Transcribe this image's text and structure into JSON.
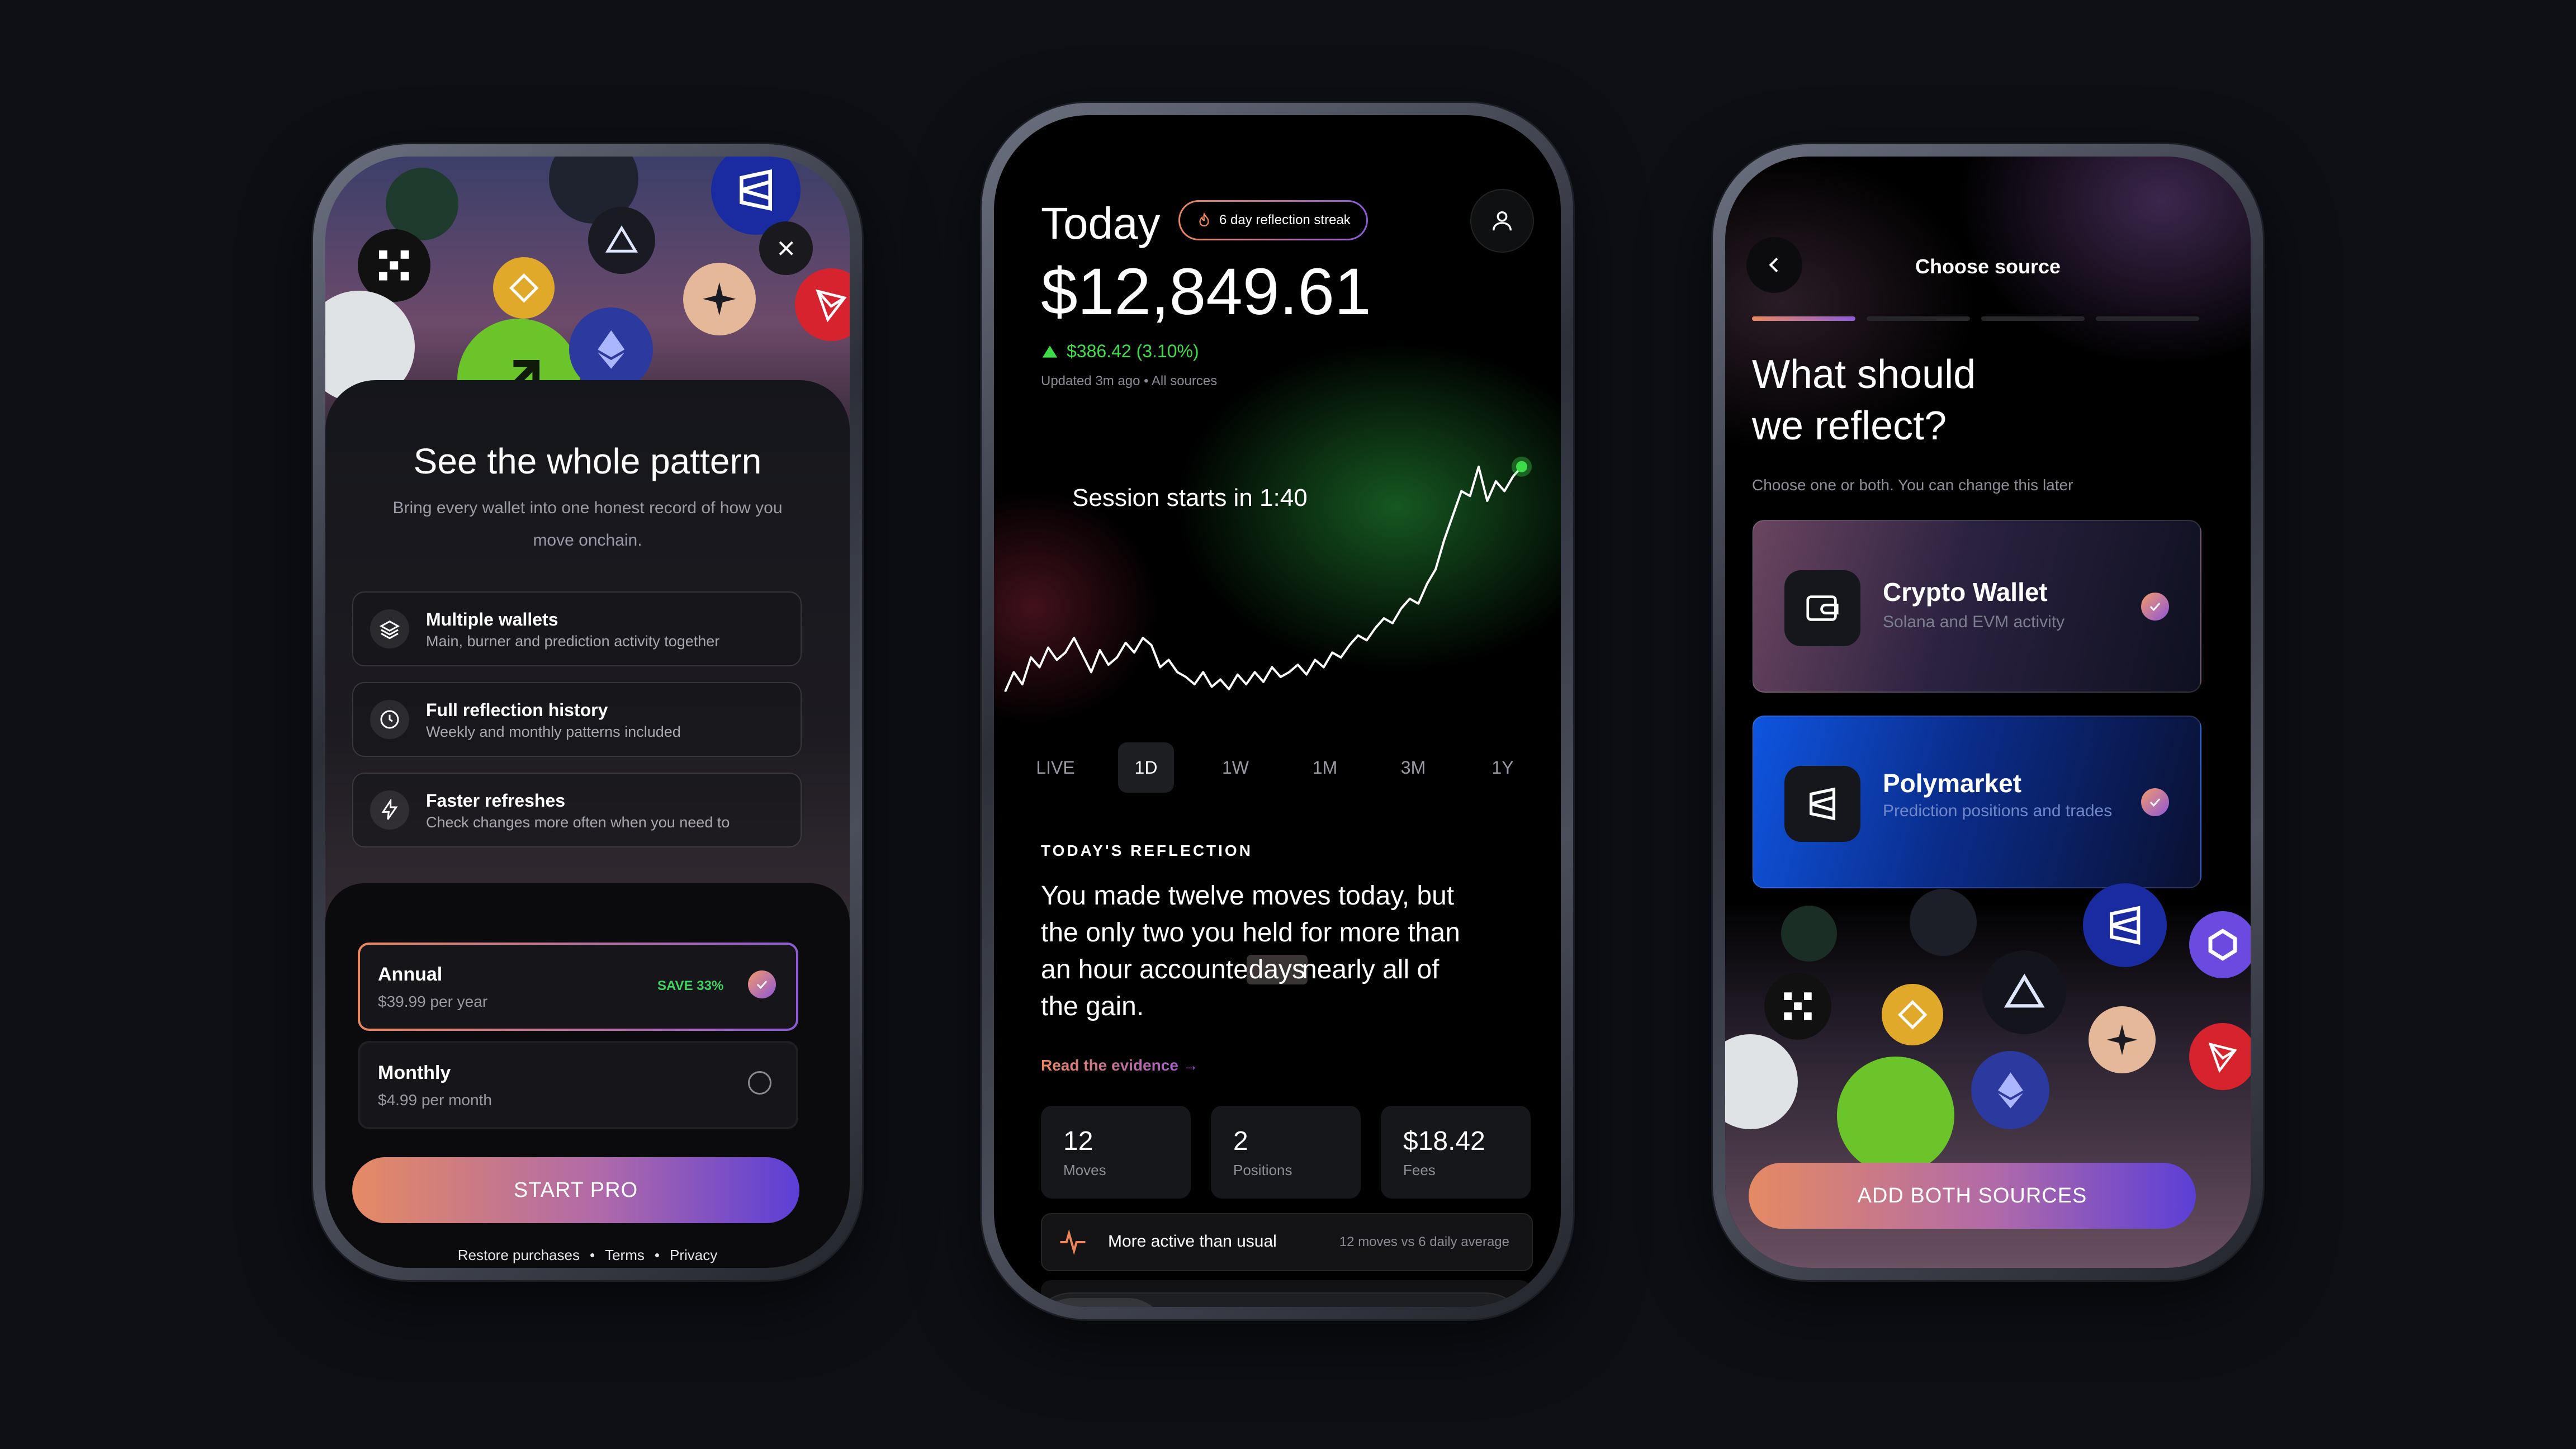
{
  "paywall": {
    "title": "See the whole pattern",
    "subtitle_line1": "Bring every wallet into one honest record of how you",
    "subtitle_line2": "move onchain.",
    "features": [
      {
        "title": "Multiple wallets",
        "desc": "Main, burner and prediction activity together",
        "icon": "layers-icon"
      },
      {
        "title": "Full reflection history",
        "desc": "Weekly and monthly patterns included",
        "icon": "clock-icon"
      },
      {
        "title": "Faster refreshes",
        "desc": "Check changes more often when you need to",
        "icon": "bolt-icon"
      }
    ],
    "plans": [
      {
        "name": "Annual",
        "price": "$39.99 per year",
        "badge": "SAVE 33%",
        "selected": true
      },
      {
        "name": "Monthly",
        "price": "$4.99 per month",
        "selected": false
      }
    ],
    "cta": "START PRO",
    "footer": {
      "restore": "Restore purchases",
      "terms": "Terms",
      "privacy": "Privacy",
      "sep": "•"
    },
    "close_icon": "close-icon"
  },
  "today": {
    "title": "Today",
    "streak": "6 day reflection streak",
    "balance": "$12,849.61",
    "change": "$386.42 (3.10%)",
    "updated": "Updated 3m ago • All sources",
    "session_label": "Session starts in 1:40",
    "timeframes": [
      "LIVE",
      "1D",
      "1W",
      "1M",
      "3M",
      "1Y"
    ],
    "active_timeframe": "1D",
    "reflection_heading": "TODAY'S REFLECTION",
    "reflection_lines": [
      "You made twelve moves today, but",
      "the only two you held for more than",
      "an hour accounted",
      "days",
      "nearly all of",
      "the gain."
    ],
    "read_evidence": "Read the evidence →",
    "stats": [
      {
        "value": "12",
        "label": "Moves"
      },
      {
        "value": "2",
        "label": "Positions"
      },
      {
        "value": "$18.42",
        "label": "Fees"
      }
    ],
    "activity": {
      "title": "More active than usual",
      "detail": "12 moves vs 6 daily average"
    },
    "nav": [
      "bolt-icon",
      "history-icon",
      "target-icon",
      "more-icon"
    ],
    "accent_green": "#3fdc4a",
    "chart_data": {
      "type": "line",
      "x": [
        0,
        1,
        2,
        3,
        4,
        5,
        6,
        7,
        8,
        9,
        10,
        11,
        12,
        13,
        14,
        15,
        16,
        17,
        18,
        19,
        20,
        21,
        22,
        23,
        24,
        25,
        26,
        27,
        28,
        29,
        30,
        31,
        32,
        33,
        34,
        35,
        36,
        37,
        38,
        39,
        40,
        41,
        42,
        43,
        44,
        45,
        46,
        47,
        48,
        49,
        50,
        51,
        52,
        53,
        54,
        55,
        56,
        57,
        58,
        59,
        60
      ],
      "values": [
        12390,
        12430,
        12405,
        12460,
        12440,
        12480,
        12455,
        12470,
        12500,
        12465,
        12430,
        12475,
        12445,
        12460,
        12490,
        12470,
        12500,
        12485,
        12440,
        12455,
        12430,
        12420,
        12405,
        12430,
        12400,
        12415,
        12395,
        12425,
        12405,
        12430,
        12410,
        12440,
        12420,
        12430,
        12445,
        12425,
        12455,
        12440,
        12470,
        12460,
        12485,
        12505,
        12495,
        12520,
        12540,
        12530,
        12560,
        12580,
        12570,
        12610,
        12640,
        12700,
        12750,
        12800,
        12790,
        12850,
        12780,
        12820,
        12800,
        12830,
        12850
      ],
      "title": "",
      "xlabel": "",
      "ylabel": "",
      "ylim": [
        12380,
        12860
      ],
      "grid": false
    }
  },
  "source": {
    "header": "Choose source",
    "question_line1": "What should",
    "question_line2": "we reflect?",
    "hint": "Choose one or both. You can change this later",
    "step": 1,
    "steps": 4,
    "options": [
      {
        "title": "Crypto Wallet",
        "desc": "Solana and EVM activity",
        "icon": "wallet-icon",
        "selected": true
      },
      {
        "title": "Polymarket",
        "desc": "Prediction positions and trades",
        "icon": "polymarket-icon",
        "selected": true
      }
    ],
    "cta": "ADD BOTH SOURCES",
    "back_icon": "chevron-left-icon"
  }
}
